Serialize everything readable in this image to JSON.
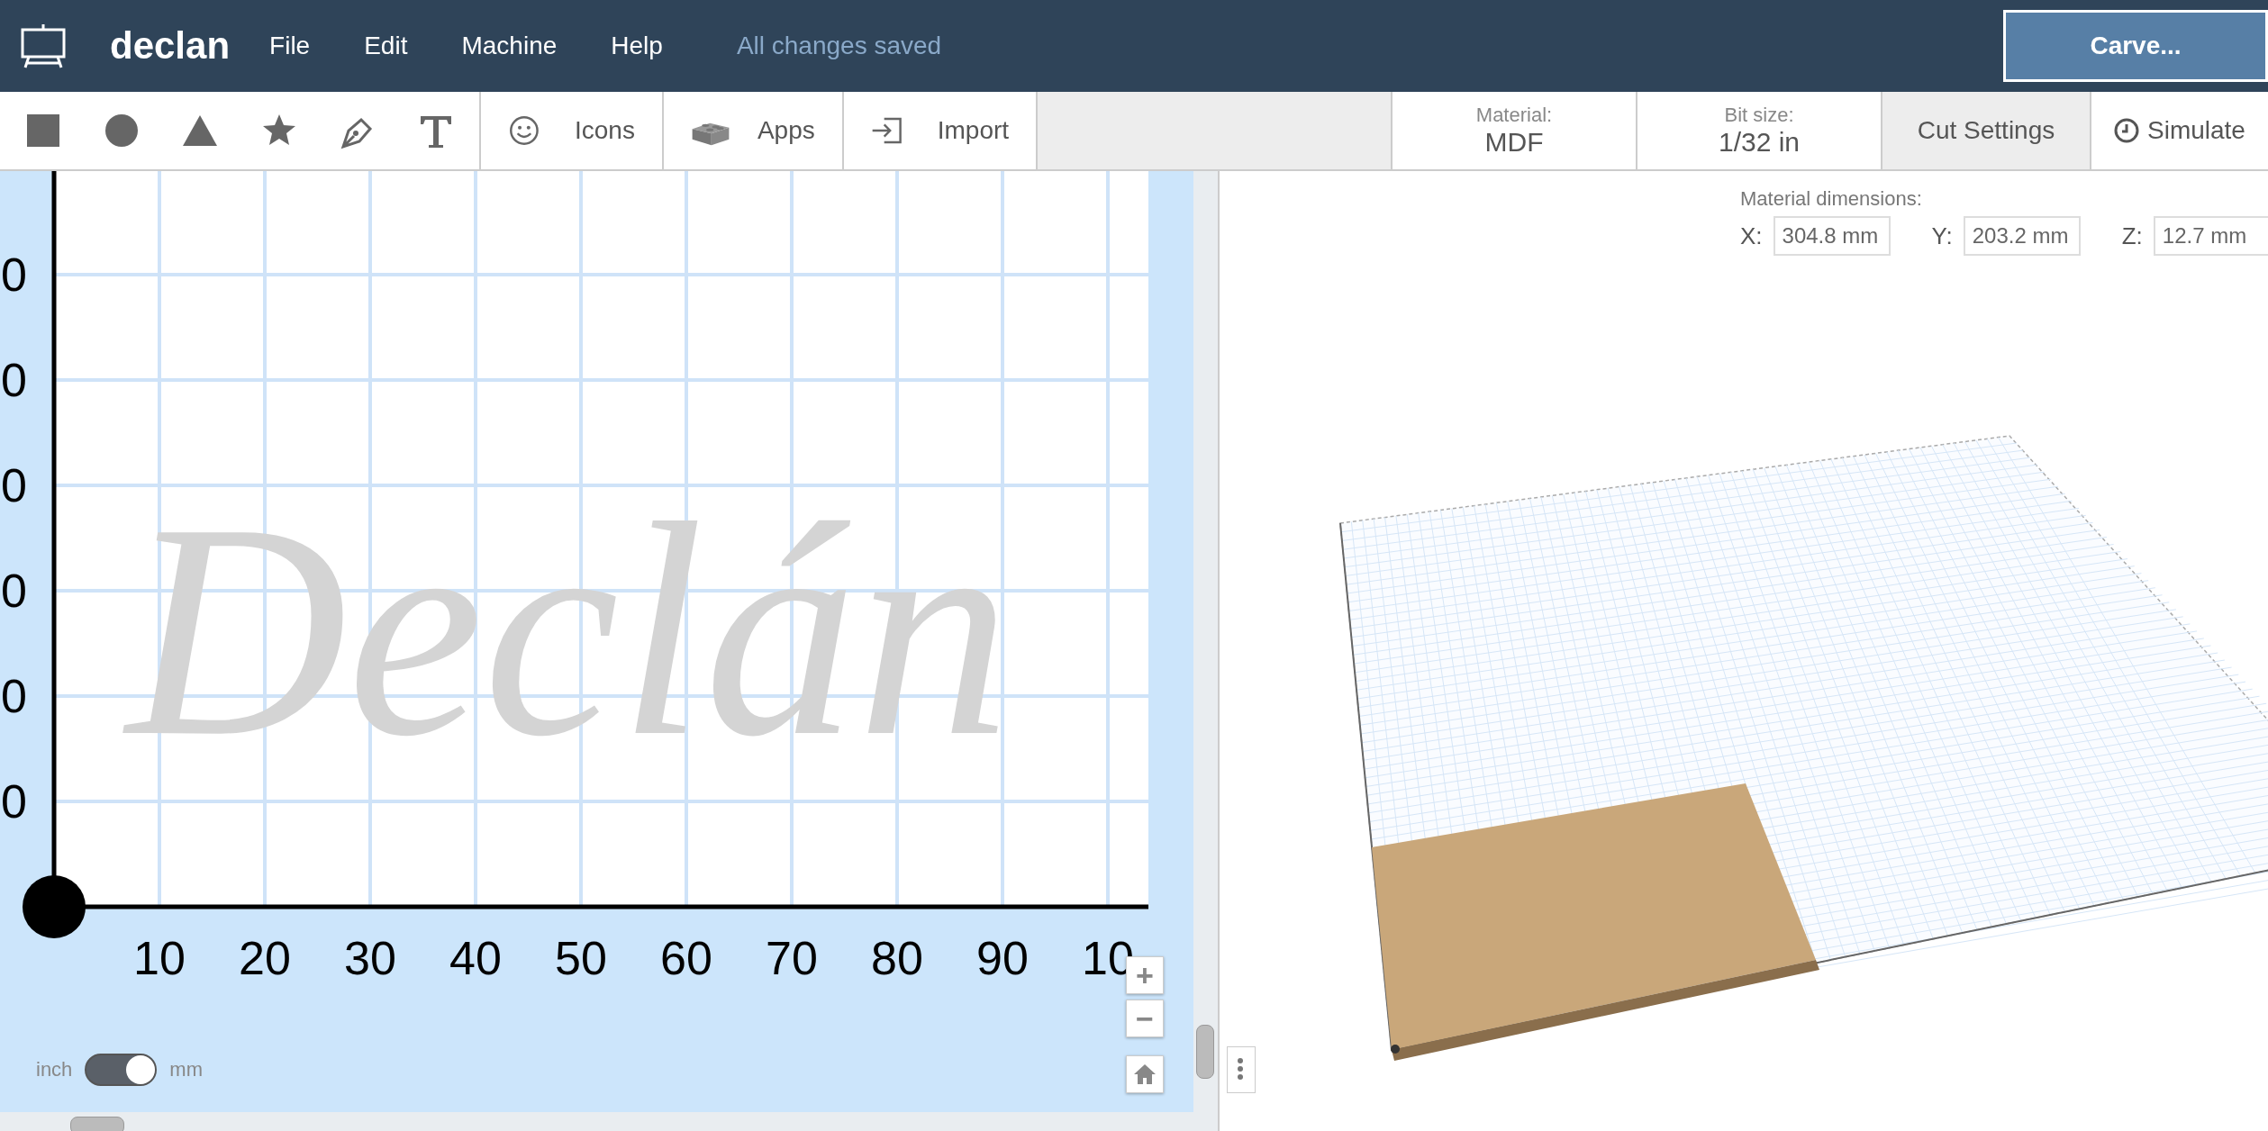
{
  "header": {
    "title": "declan",
    "menu": [
      "File",
      "Edit",
      "Machine",
      "Help"
    ],
    "save_status": "All changes saved",
    "carve_button": "Carve..."
  },
  "toolbar": {
    "tools": [
      {
        "kind": "icons",
        "label": "Icons"
      },
      {
        "kind": "apps",
        "label": "Apps"
      },
      {
        "kind": "import",
        "label": "Import"
      }
    ],
    "material": {
      "label": "Material:",
      "value": "MDF"
    },
    "bit_size": {
      "label": "Bit size:",
      "value": "1/32 in"
    },
    "cut_settings": "Cut Settings",
    "simulate": "Simulate"
  },
  "design_canvas": {
    "design_text": "Declán",
    "x_axis_labels": [
      "10",
      "20",
      "30",
      "40",
      "50",
      "60",
      "70",
      "80",
      "90",
      "10"
    ],
    "y_axis_labels": [
      "0",
      "0",
      "0",
      "0",
      "0",
      "0"
    ],
    "zoom_in": "+",
    "zoom_out": "−",
    "unit_toggle": {
      "left_label": "inch",
      "right_label": "mm",
      "on": true
    }
  },
  "preview": {
    "dimensions_label": "Material dimensions:",
    "fields": [
      {
        "axis": "X:",
        "value": "304.8 mm"
      },
      {
        "axis": "Y:",
        "value": "203.2 mm"
      },
      {
        "axis": "Z:",
        "value": "12.7 mm"
      }
    ]
  }
}
